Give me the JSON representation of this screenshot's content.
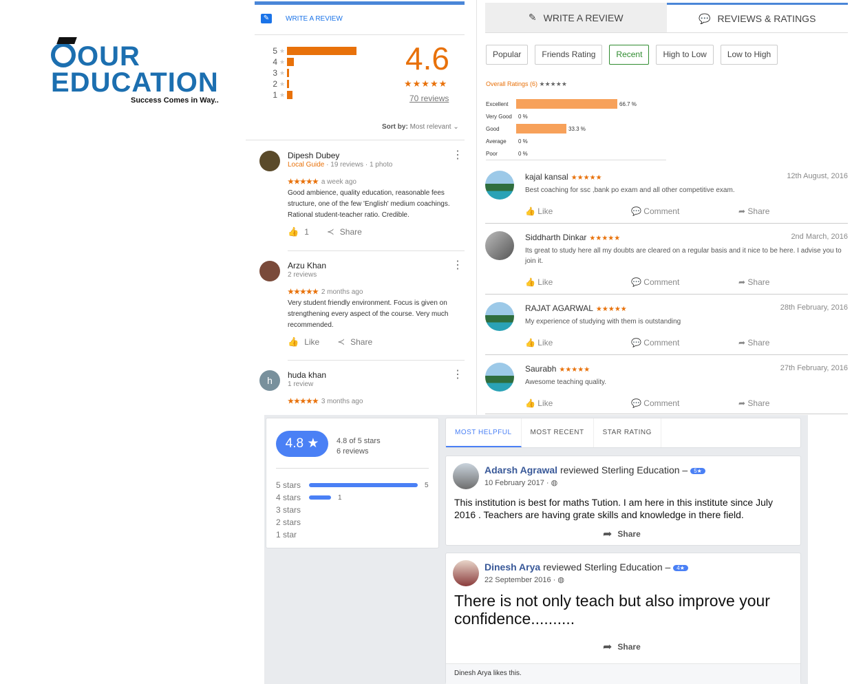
{
  "logo": {
    "line1": "OUR",
    "line2": "EDUCATION",
    "tagline": "Success Comes in Way.."
  },
  "google": {
    "write_label": "WRITE A REVIEW",
    "histogram": [
      {
        "stars": "5",
        "fraction": 0.81
      },
      {
        "stars": "4",
        "fraction": 0.08
      },
      {
        "stars": "3",
        "fraction": 0.01
      },
      {
        "stars": "2",
        "fraction": 0.01
      },
      {
        "stars": "1",
        "fraction": 0.06
      }
    ],
    "rating": "4.6",
    "stars": "★★★★★",
    "count": "70 reviews",
    "sort_label": "Sort by:",
    "sort_value": "Most relevant ⌄",
    "reviews": [
      {
        "name": "Dipesh Dubey",
        "guide": "Local Guide",
        "meta": " · 19 reviews · 1 photo",
        "stars": "★★★★★",
        "when": "a week ago",
        "text": "Good ambience, quality education, reasonable fees structure, one of the few 'English' medium coachings. Rational student-teacher ratio. Credible.",
        "like": "1",
        "share": "Share"
      },
      {
        "name": "Arzu Khan",
        "guide": "",
        "meta": "2 reviews",
        "stars": "★★★★★",
        "when": "2 months ago",
        "text": "Very student friendly environment. Focus is given on strengthening every aspect of the course. Very much recommended.",
        "like": "Like",
        "share": "Share"
      },
      {
        "name": "huda khan",
        "guide": "",
        "meta": "1 review",
        "stars": "★★★★★",
        "when": "3 months ago",
        "initial": "h"
      }
    ]
  },
  "ratings": {
    "tab_write": "WRITE A REVIEW",
    "tab_reviews": "REVIEWS & RATINGS",
    "filters": [
      "Popular",
      "Friends Rating",
      "Recent",
      "High to Low",
      "Low to High"
    ],
    "overall_label": "Overall Ratings (6)",
    "overall_stars": "★★★★★",
    "stats": [
      {
        "label": "Excellent",
        "pct": "66.7 %",
        "value": 66.7
      },
      {
        "label": "Very Good",
        "pct": "0 %",
        "value": 0
      },
      {
        "label": "Good",
        "pct": "33.3 %",
        "value": 33.3
      },
      {
        "label": "Average",
        "pct": "0 %",
        "value": 0
      },
      {
        "label": "Poor",
        "pct": "0 %",
        "value": 0
      }
    ],
    "reviews": [
      {
        "name": "kajal kansal",
        "stars": "★★★★★",
        "date": "12th August, 2016",
        "text": "Best coaching for ssc ,bank po exam and all other competitive exam."
      },
      {
        "name": "Siddharth Dinkar",
        "stars": "★★★★★",
        "date": "2nd March, 2016",
        "text": "Its great to study here all my doubts are cleared on a regular basis and it nice to be here. I advise you to join it."
      },
      {
        "name": "RAJAT AGARWAL",
        "stars": "★★★★★",
        "date": "28th February, 2016",
        "text": "My experience of studying with them is outstanding"
      },
      {
        "name": "Saurabh",
        "stars": "★★★★★",
        "date": "27th February, 2016",
        "text": "Awesome teaching quality."
      }
    ],
    "actions": {
      "like": "Like",
      "comment": "Comment",
      "share": "Share"
    }
  },
  "fb": {
    "score": "4.8 ★",
    "of_stars": "4.8 of 5 stars",
    "reviews_count": "6 reviews",
    "rows": [
      {
        "label": "5 stars",
        "count": "5",
        "fraction": 0.83
      },
      {
        "label": "4 stars",
        "count": "1",
        "fraction": 0.17
      },
      {
        "label": "3 stars",
        "count": "",
        "fraction": 0
      },
      {
        "label": "2 stars",
        "count": "",
        "fraction": 0
      },
      {
        "label": "1 star",
        "count": "",
        "fraction": 0
      }
    ],
    "tabs": [
      "MOST HELPFUL",
      "MOST RECENT",
      "STAR RATING"
    ],
    "posts": [
      {
        "name": "Adarsh Agrawal",
        "reviewed": " reviewed Sterling Education –",
        "badge": "5★",
        "date": "10 February 2017 · ◍",
        "text": "This institution is best for maths Tution. I am here in this institute since July 2016 . Teachers are having grate skills and knowledge in there field.",
        "share": "Share"
      },
      {
        "name": "Dinesh Arya",
        "reviewed": " reviewed Sterling Education –",
        "badge": "4★",
        "date": "22 September 2016 · ◍",
        "text": "There is not only teach but also improve your confidence..........",
        "share": "Share",
        "likes": "Dinesh Arya likes this."
      }
    ]
  }
}
